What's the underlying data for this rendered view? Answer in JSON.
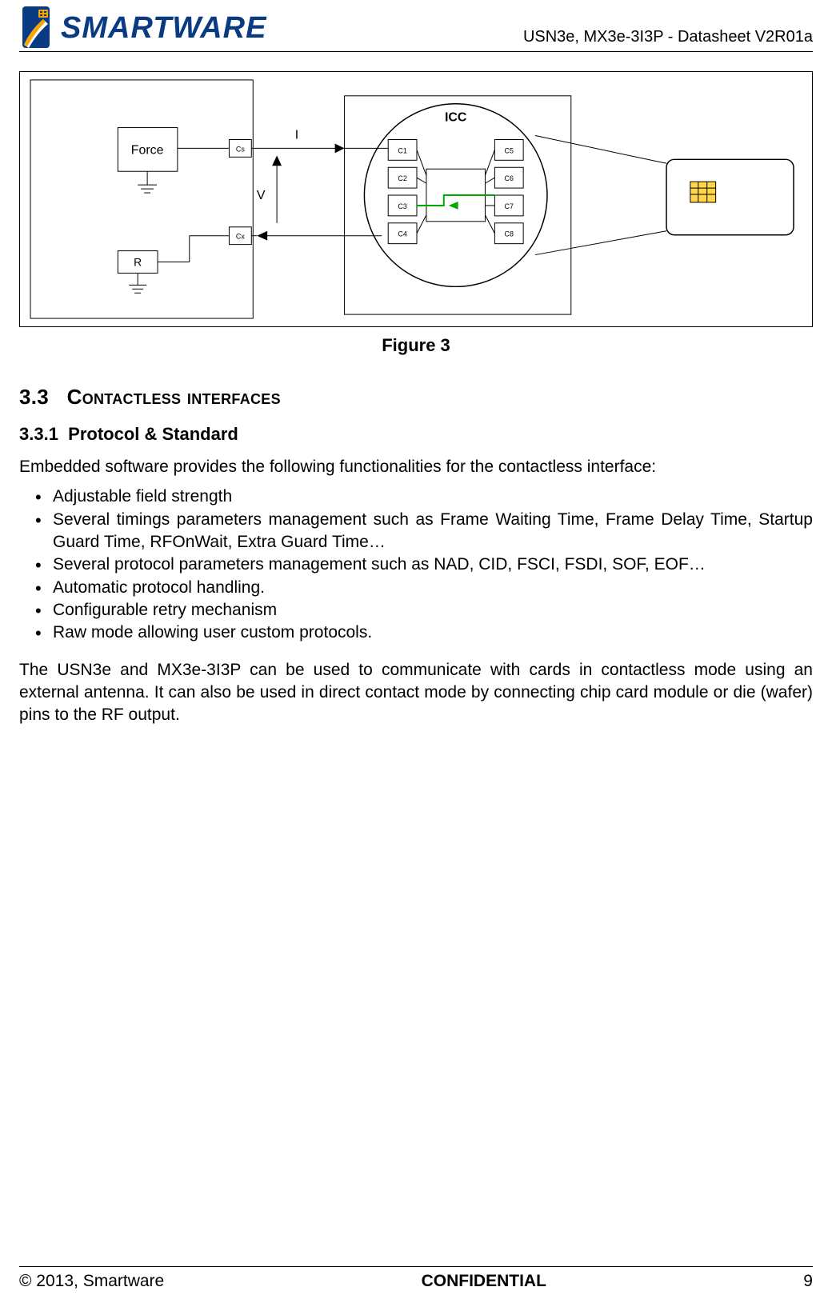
{
  "header": {
    "brand": "SMARTWARE",
    "doc_id": "USN3e, MX3e-3I3P - Datasheet V2R01a"
  },
  "figure": {
    "caption": "Figure 3",
    "labels": {
      "force": "Force",
      "r": "R",
      "cs": "Cs",
      "cx": "Cx",
      "i": "I",
      "v": "V",
      "icc": "ICC",
      "c1": "C1",
      "c2": "C2",
      "c3": "C3",
      "c4": "C4",
      "c5": "C5",
      "c6": "C6",
      "c7": "C7",
      "c8": "C8"
    }
  },
  "section": {
    "number": "3.3",
    "title": "Contactless interfaces",
    "sub_number": "3.3.1",
    "sub_title": "Protocol & Standard",
    "intro": "Embedded software provides the following functionalities for the contactless interface:",
    "bullets": [
      "Adjustable field strength",
      "Several timings parameters management such as Frame Waiting Time, Frame Delay Time, Startup Guard Time, RFOnWait, Extra Guard Time…",
      "Several protocol parameters management such as NAD, CID, FSCI, FSDI, SOF, EOF…",
      "Automatic protocol handling.",
      "Configurable retry mechanism",
      "Raw mode allowing user custom protocols."
    ],
    "para": "The USN3e and MX3e-3I3P can be used to communicate with cards in contactless mode using an external antenna. It can also be used in direct contact mode by connecting chip card module or die (wafer) pins to the RF output."
  },
  "footer": {
    "copyright": "© 2013, Smartware",
    "confidential": "CONFIDENTIAL",
    "page": "9"
  }
}
